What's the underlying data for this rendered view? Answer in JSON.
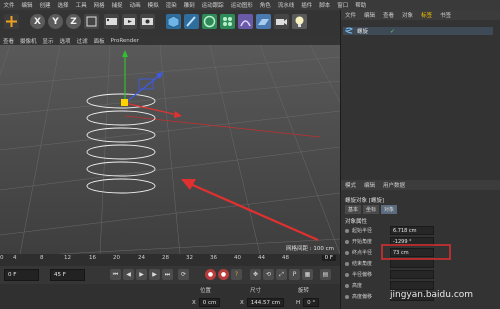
{
  "menubar": {
    "items": [
      "文件",
      "编辑",
      "创建",
      "选择",
      "工具",
      "网格",
      "捕捉",
      "动画",
      "模拟",
      "渲染",
      "雕刻",
      "运动跟踪",
      "运动图形",
      "角色",
      "流水线",
      "插件",
      "脚本",
      "窗口",
      "帮助"
    ]
  },
  "toolbar": {
    "axis_labels": [
      "X",
      "Y",
      "Z"
    ]
  },
  "viewport_menu": {
    "items": [
      "查看",
      "摄像机",
      "显示",
      "选项",
      "过滤",
      "面板",
      "ProRender"
    ]
  },
  "viewport": {
    "grid_spacing_text": "网格间距 : 100 cm"
  },
  "object_manager": {
    "tabs": [
      "文件",
      "编辑",
      "查看",
      "对象",
      "标签",
      "书签"
    ],
    "selected_tab_index": 4,
    "objects": [
      {
        "name": "螺旋"
      }
    ]
  },
  "attributes": {
    "tabs": [
      "模式",
      "编辑",
      "用户数据"
    ],
    "header": "螺旋对象 [螺旋]",
    "subtabs": [
      "基本",
      "坐标",
      "对象"
    ],
    "section_title": "对象属性",
    "params": [
      {
        "label": "起始半径",
        "value": "6.718 cm"
      },
      {
        "label": "开始角度",
        "value": "-1299 °"
      },
      {
        "label": "终点半径",
        "value": "73 cm"
      },
      {
        "label": "结束角度",
        "value": ""
      },
      {
        "label": "半径偏移",
        "value": ""
      },
      {
        "label": "高度",
        "value": ""
      },
      {
        "label": "高度偏移",
        "value": ""
      }
    ]
  },
  "timeline": {
    "ticks": [
      "0",
      "4",
      "8",
      "12",
      "16",
      "20",
      "24",
      "28",
      "32",
      "36",
      "40",
      "44",
      "48",
      "52",
      "56",
      "60",
      "64",
      "68",
      "72",
      "76",
      "80",
      "84",
      "88",
      "90"
    ],
    "current_frame": "0 F"
  },
  "playback": {
    "start_field": "0 F",
    "end_field": "45 F"
  },
  "coordinates": {
    "headers": [
      "位置",
      "尺寸",
      "旋转"
    ],
    "x_label": "X",
    "pos_x": "0 cm",
    "size_x": "144.57 cm",
    "rot_label": "H",
    "rot_h": "0 °"
  },
  "watermark": "jingyan.baidu.com",
  "colors": {
    "annotation_red": "#e03030",
    "axis_x": "#e03232",
    "axis_y": "#30c030",
    "axis_z": "#3c5af0",
    "highlight_tab": "#f3c300"
  }
}
